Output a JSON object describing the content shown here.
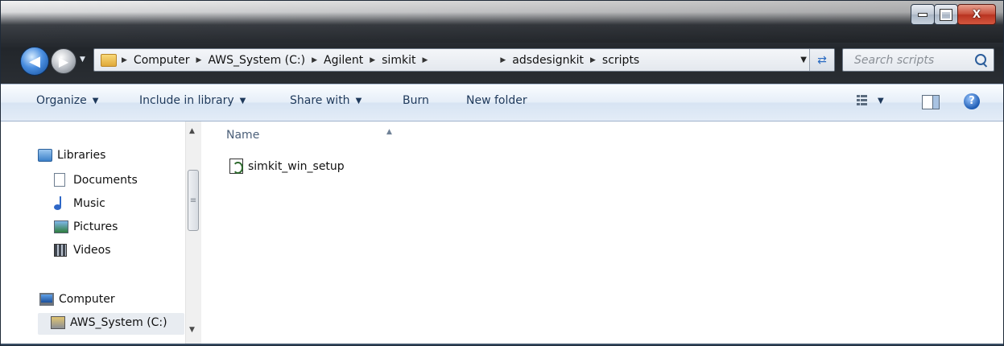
{
  "window": {
    "caption": {
      "close_label": "X"
    }
  },
  "address_bar": {
    "crumbs": [
      "Computer",
      "AWS_System (C:)",
      "Agilent",
      "simkit",
      "adsdesignkit",
      "scripts"
    ]
  },
  "search": {
    "placeholder": "Search scripts"
  },
  "toolbar": {
    "organize": "Organize",
    "include_in_library": "Include in library",
    "share_with": "Share with",
    "burn": "Burn",
    "new_folder": "New folder"
  },
  "nav_pane": {
    "libraries": "Libraries",
    "documents": "Documents",
    "music": "Music",
    "pictures": "Pictures",
    "videos": "Videos",
    "computer": "Computer",
    "drive": "AWS_System (C:)"
  },
  "content": {
    "column_header": "Name",
    "files": [
      {
        "name": "simkit_win_setup"
      }
    ]
  },
  "icons": {
    "back": "back-arrow-icon",
    "forward": "forward-arrow-icon",
    "refresh": "refresh-icon",
    "search": "search-icon",
    "help": "help-icon"
  },
  "colors": {
    "toolbar_text": "#1e395b",
    "selection": "#e8ecf1"
  }
}
